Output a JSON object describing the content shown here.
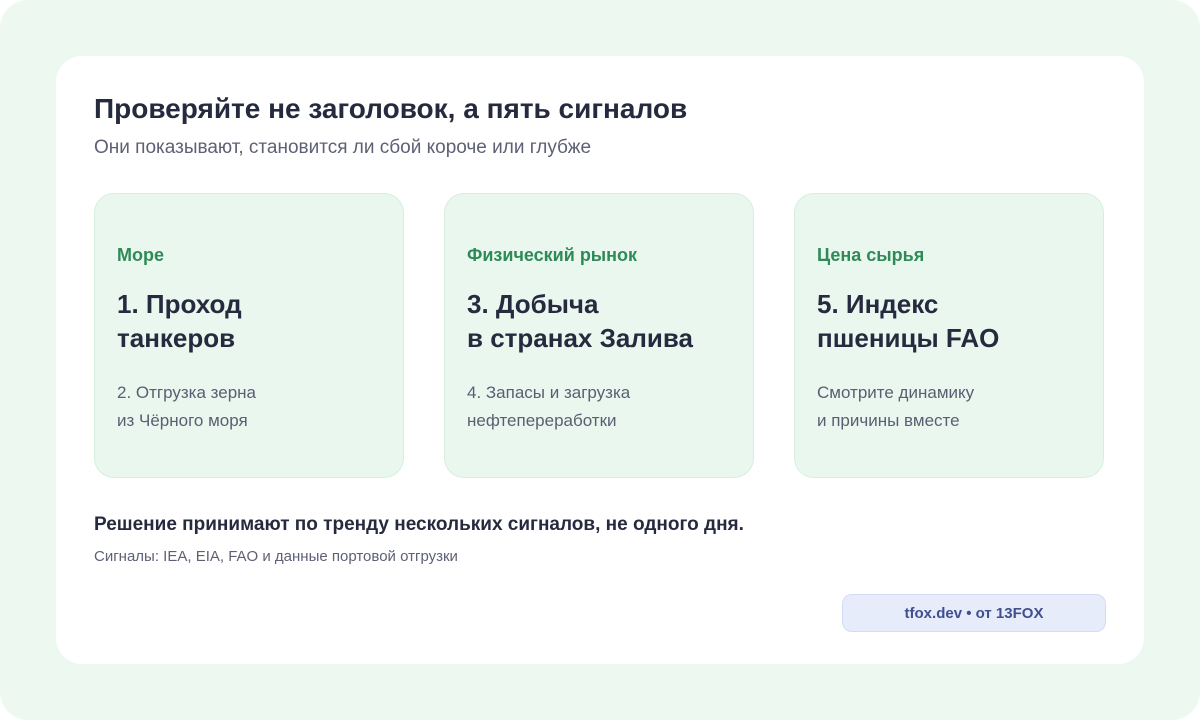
{
  "header": {
    "title": "Проверяйте не заголовок, а пять сигналов",
    "subtitle": "Они показывают, становится ли сбой короче или глубже"
  },
  "tiles": [
    {
      "tag": "Море",
      "heading_lines": [
        "1. Проход",
        "танкеров"
      ],
      "note_lines": [
        "2. Отгрузка зерна",
        "из Чёрного моря"
      ]
    },
    {
      "tag": "Физический рынок",
      "heading_lines": [
        "3. Добыча",
        "в странах Залива"
      ],
      "note_lines": [
        "4. Запасы и загрузка",
        "нефтепереработки"
      ]
    },
    {
      "tag": "Цена сырья",
      "heading_lines": [
        "5. Индекс",
        "пшеницы FAO"
      ],
      "note_lines": [
        "Смотрите динамику",
        "и причины вместе"
      ]
    }
  ],
  "footer": {
    "decision": "Решение принимают по тренду нескольких сигналов, не одного дня.",
    "sources": "Сигналы: IEA, EIA, FAO и данные портовой отгрузки",
    "badge": "tfox.dev • от 13FOX"
  },
  "colors": {
    "background": "#edf8f0",
    "card": "#ffffff",
    "tile": "#eaf7ee",
    "tag": "#2f8a58",
    "text": "#262a3f",
    "muted": "#5e6175",
    "badge_bg": "#e7ecfb",
    "badge_text": "#414f8f"
  }
}
